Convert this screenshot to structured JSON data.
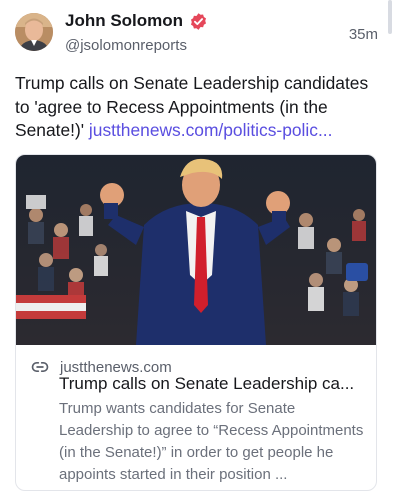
{
  "author": {
    "name": "John Solomon",
    "handle": "@jsolomonreports"
  },
  "post": {
    "time": "35m",
    "text": "Trump calls on Senate Leadership candidates to 'agree to Recess Appointments (in the Senate!)' ",
    "link_text": "justthenews.com/politics-polic..."
  },
  "link_card": {
    "domain": "justthenews.com",
    "title": "Trump calls on Senate Leadership ca...",
    "description": "Trump wants candidates for Senate Leadership to agree to “Recess Appointments (in the Senate!)” in order to get people he appoints started in their position ..."
  },
  "colors": {
    "link": "#5a4ee0",
    "verified_badge": "#e5475a",
    "secondary_text": "#5a5f6a"
  },
  "icons": [
    "verified-badge-icon",
    "link-icon"
  ]
}
